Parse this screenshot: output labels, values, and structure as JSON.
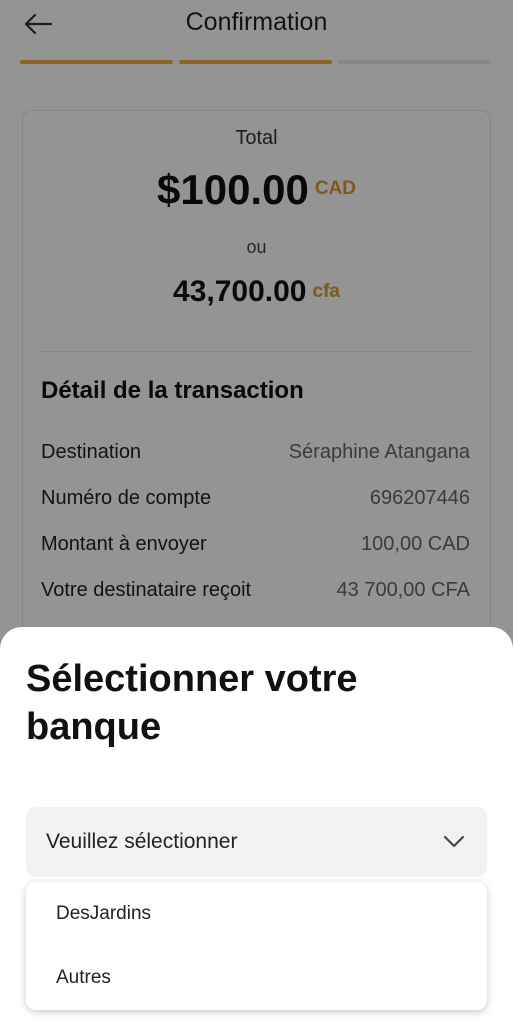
{
  "header": {
    "title": "Confirmation",
    "back_icon": "arrow-left-icon"
  },
  "progress": {
    "steps_total": 3,
    "steps_completed": 2,
    "active_color": "#f2ad3d"
  },
  "summary": {
    "total_label": "Total",
    "amount": "$100.00",
    "amount_currency": "CAD",
    "or_label": "ou",
    "converted_amount": "43,700.00",
    "converted_currency": "cfa"
  },
  "details": {
    "title": "Détail de la transaction",
    "rows": [
      {
        "label": "Destination",
        "value": "Séraphine Atangana"
      },
      {
        "label": "Numéro de compte",
        "value": "696207446"
      },
      {
        "label": "Montant à envoyer",
        "value": "100,00 CAD"
      },
      {
        "label": "Votre destinataire reçoit",
        "value": "43 700,00 CFA"
      }
    ]
  },
  "sheet": {
    "title": "Sélectionner votre banque",
    "select": {
      "value": "Veuillez sélectionner",
      "icon": "chevron-down-icon"
    },
    "options": [
      {
        "label": "DesJardins"
      },
      {
        "label": "Autres"
      }
    ]
  },
  "colors": {
    "accent": "#f2ad3d",
    "currency": "#d99a2b"
  }
}
